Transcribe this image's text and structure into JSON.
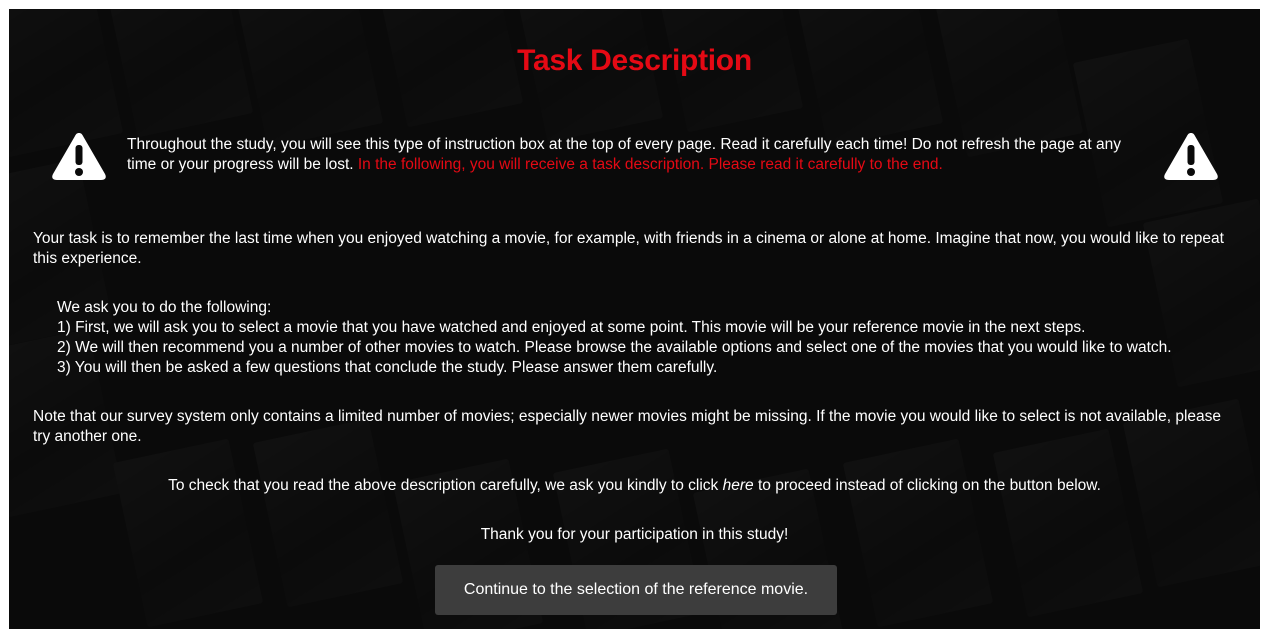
{
  "page": {
    "title": "Task Description"
  },
  "instruction_box": {
    "icon": "warning-triangle-icon",
    "text_white": "Throughout the study, you will see this type of instruction box at the top of every page. Read it carefully each time! Do not refresh the page at any time or your progress will be lost. ",
    "text_red": "In the following, you will receive a task description. Please read it carefully to the end."
  },
  "task": {
    "paragraph": "Your task is to remember the last time when you enjoyed watching a movie, for example, with friends in a cinema or alone at home. Imagine that now, you would like to repeat this experience."
  },
  "steps": {
    "intro": "We ask you to do the following:",
    "items": [
      "1) First, we will ask you to select a movie that you have watched and enjoyed at some point. This movie will be your reference movie in the next steps.",
      "2) We will then recommend you a number of other movies to watch. Please browse the available options and select one of the movies that you would like to watch.",
      "3) You will then be asked a few questions that conclude the study. Please answer them carefully."
    ]
  },
  "note": {
    "paragraph": "Note that our survey system only contains a limited number of movies; especially newer movies might be missing. If the movie you would like to select is not available, please try another one."
  },
  "check": {
    "before": "To check that you read the above description carefully, we ask you kindly to click ",
    "link": "here",
    "after": " to proceed instead of clicking on the button below."
  },
  "thanks": {
    "text": "Thank you for your participation in this study!"
  },
  "button": {
    "label": "Continue to the selection of the reference movie."
  },
  "colors": {
    "accent_red": "#e50914",
    "background": "#0a0a0a",
    "button_bg": "#3d3d3d"
  }
}
